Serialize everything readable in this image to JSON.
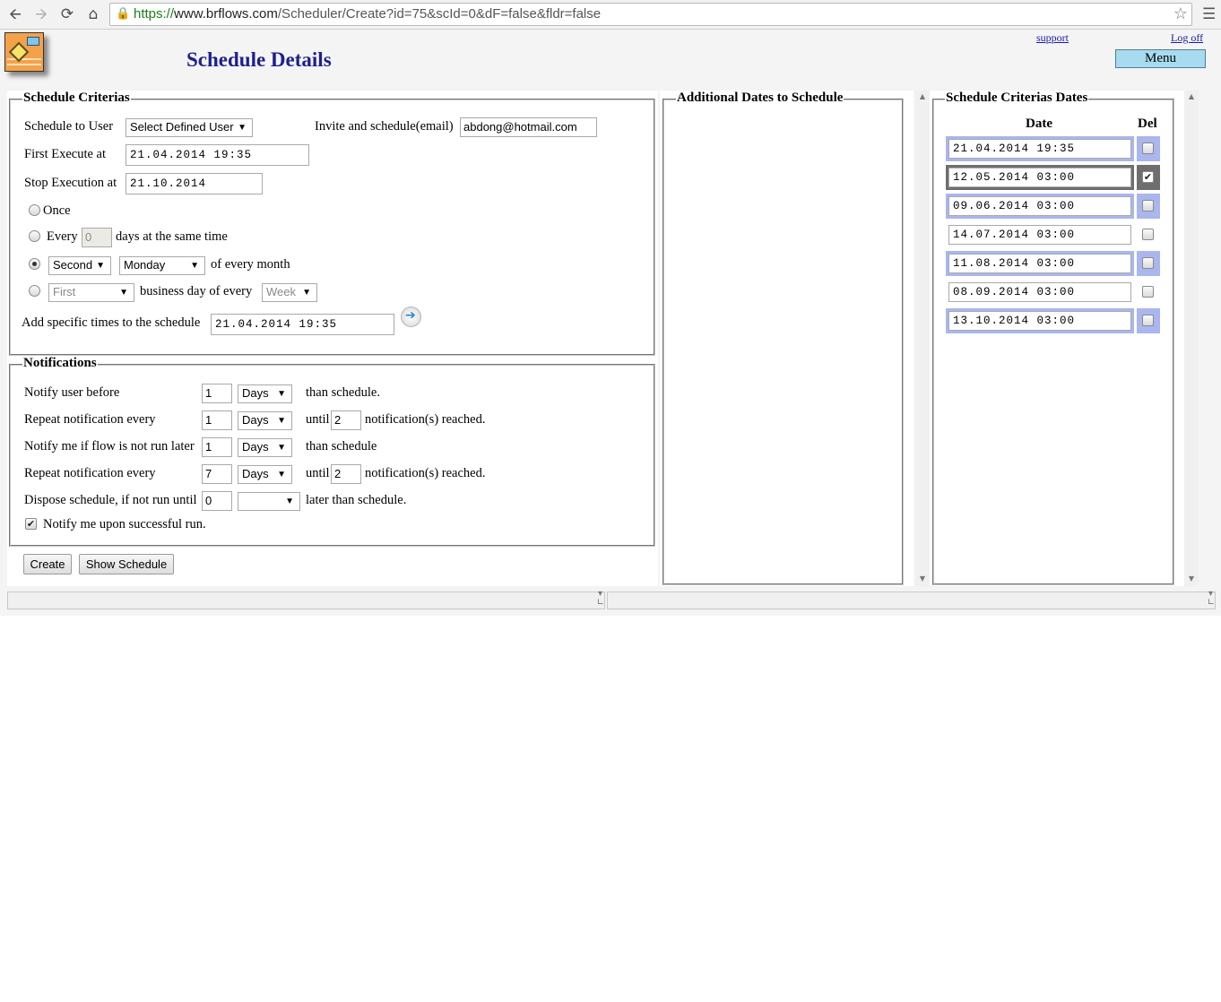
{
  "browser": {
    "url_scheme": "https://",
    "url_host": "www.brflows.com",
    "url_path": "/Scheduler/Create?id=75&scId=0&dF=false&fldr=false"
  },
  "header": {
    "title": "Schedule Details",
    "support_link": "support",
    "logoff_link": "Log off",
    "menu_button": "Menu"
  },
  "criterias": {
    "legend": "Schedule Criterias",
    "schedule_to_user_label": "Schedule to User",
    "schedule_to_user_value": "Select Defined User",
    "invite_label": "Invite and schedule(email)",
    "invite_email": "abdong@hotmail.com",
    "first_execute_label": "First Execute at",
    "first_execute_value": "21.04.2014 19:35",
    "stop_execution_label": "Stop Execution at",
    "stop_execution_value": "21.10.2014",
    "once_label": "Once",
    "every_label": "Every",
    "every_days_value": "0",
    "every_suffix": "days at the same time",
    "ordinal_value": "Second",
    "weekday_value": "Monday",
    "of_every_month": "of every month",
    "business_ordinal_value": "First",
    "business_label": "business day of every",
    "business_period_value": "Week",
    "specific_times_label": "Add specific times to the schedule",
    "specific_times_value": "21.04.2014 19:35",
    "selected_option": "ordinal-weekday"
  },
  "notifications": {
    "legend": "Notifications",
    "rows": [
      {
        "label": "Notify user before",
        "value": "1",
        "unit": "Days",
        "suffix": "than schedule."
      },
      {
        "label": "Repeat notification every",
        "value": "1",
        "unit": "Days",
        "until_label": "until",
        "until_value": "2",
        "suffix": "notification(s) reached."
      },
      {
        "label": "Notify me if flow is not run later",
        "value": "1",
        "unit": "Days",
        "suffix": "than schedule"
      },
      {
        "label": "Repeat notification every",
        "value": "7",
        "unit": "Days",
        "until_label": "until",
        "until_value": "2",
        "suffix": "notification(s) reached."
      },
      {
        "label": "Dispose schedule, if not run until",
        "value": "0",
        "unit": "",
        "suffix": "later than schedule."
      }
    ],
    "notify_success_label": "Notify me upon successful run.",
    "notify_success_checked": true
  },
  "actions": {
    "create": "Create",
    "show_schedule": "Show Schedule"
  },
  "additional_dates": {
    "legend": "Additional Dates to Schedule"
  },
  "criteria_dates": {
    "legend": "Schedule Criterias Dates",
    "date_header": "Date",
    "del_header": "Del",
    "rows": [
      {
        "date": "21.04.2014 19:35",
        "checked": false,
        "style": "hl"
      },
      {
        "date": "12.05.2014 03:00",
        "checked": true,
        "style": "dark"
      },
      {
        "date": "09.06.2014 03:00",
        "checked": false,
        "style": "hl"
      },
      {
        "date": "14.07.2014 03:00",
        "checked": false,
        "style": "plain"
      },
      {
        "date": "11.08.2014 03:00",
        "checked": false,
        "style": "hl"
      },
      {
        "date": "08.09.2014 03:00",
        "checked": false,
        "style": "plain"
      },
      {
        "date": "13.10.2014 03:00",
        "checked": false,
        "style": "hl"
      }
    ]
  },
  "icons": {
    "back": "back-arrow-icon",
    "forward": "forward-arrow-icon",
    "reload": "reload-icon",
    "home": "home-icon",
    "lock": "lock-icon",
    "bookmark": "star-icon",
    "chrome_menu": "hamburger-menu-icon",
    "go": "arrow-right-icon",
    "logo": "app-logo"
  }
}
